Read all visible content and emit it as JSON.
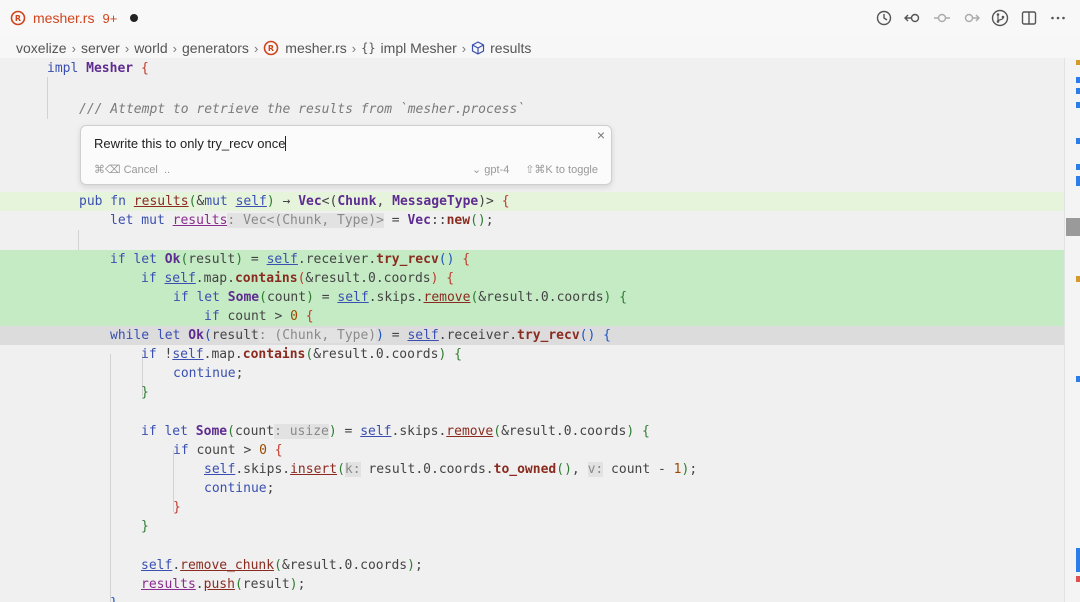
{
  "tab": {
    "file_name": "mesher.rs",
    "problem_count": "9+"
  },
  "breadcrumb": {
    "items": [
      "voxelize",
      "server",
      "world",
      "generators",
      "mesher.rs",
      "impl Mesher",
      "results"
    ]
  },
  "toolbar": {
    "icons": [
      "history-icon",
      "back-icon",
      "commit-icon",
      "forward-icon",
      "source-control-icon",
      "split-editor-icon",
      "more-icon"
    ]
  },
  "prompt": {
    "input_value": "Rewrite this to only try_recv once",
    "cancel_label": "⌘⌫ Cancel",
    "ellipsis": "..",
    "model_label": "⌄ gpt-4",
    "toggle_label": "⇧⌘K to toggle"
  },
  "code": {
    "impl_kw": "impl",
    "impl_type": "Mesher",
    "doc_comment": "/// Attempt to retrieve the results from `mesher.process`",
    "fn_sig": "results",
    "ret_type": "Vec",
    "tuple_a": "Chunk",
    "tuple_b": "MessageType",
    "let_var": "results",
    "let_hint": ": Vec<(Chunk, Type)>",
    "vec_new": "Vec",
    "new_fn": "new",
    "num0": "0",
    "num1": "1",
    "while_hint": ": (Chunk, Type)",
    "count_hint": ": usize",
    "k_hint": "k:",
    "v_hint": "v:"
  },
  "colors": {
    "accent_rust": "#d0441c",
    "added_line": "#c5ebc5",
    "removed_line": "#dcdcdc"
  }
}
